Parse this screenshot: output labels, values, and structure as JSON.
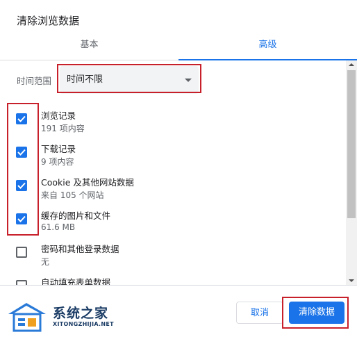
{
  "dialog": {
    "title": "清除浏览数据",
    "tabs": [
      {
        "label": "基本",
        "active": false
      },
      {
        "label": "高级",
        "active": true
      }
    ],
    "time_range": {
      "label": "时间范围",
      "selected": "时间不限"
    },
    "items": [
      {
        "title": "浏览记录",
        "subtitle": "191 项内容",
        "checked": true
      },
      {
        "title": "下载记录",
        "subtitle": "9 项内容",
        "checked": true
      },
      {
        "title": "Cookie 及其他网站数据",
        "subtitle": "来自 105 个网站",
        "checked": true
      },
      {
        "title": "缓存的图片和文件",
        "subtitle": "61.6 MB",
        "checked": true
      },
      {
        "title": "密码和其他登录数据",
        "subtitle": "无",
        "checked": false
      },
      {
        "title": "自动填充表单数据",
        "subtitle": "",
        "checked": false
      }
    ],
    "buttons": {
      "cancel": "取消",
      "clear": "清除数据"
    }
  },
  "watermark": {
    "name": "系统之家",
    "domain": "XITONGZHIJIA.NET"
  },
  "colors": {
    "accent": "#1a73e8",
    "highlight": "#c8202b",
    "text": "#202124",
    "secondary_text": "#5f6368"
  }
}
